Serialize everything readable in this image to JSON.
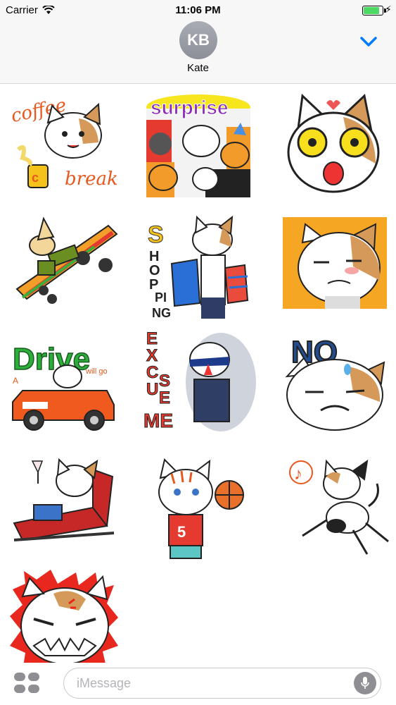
{
  "status_bar": {
    "carrier": "Carrier",
    "time": "11:06 PM",
    "icons": [
      "wifi-icon",
      "battery-icon",
      "charging-bolt-icon"
    ]
  },
  "header": {
    "avatar_initials": "KB",
    "contact_name": "Kate",
    "collapse_icon": "chevron-down-icon",
    "accent_color": "#007aff"
  },
  "stickers": [
    {
      "caption": "coffee break"
    },
    {
      "caption": "surprise"
    },
    {
      "caption": ""
    },
    {
      "caption": ""
    },
    {
      "caption": "SHOPPING"
    },
    {
      "caption": ""
    },
    {
      "caption": "Drive",
      "sub_a": "A",
      "sub_b": "will go"
    },
    {
      "caption": "EXCUSE ME"
    },
    {
      "caption": "NO"
    },
    {
      "caption": ""
    },
    {
      "caption": "5"
    },
    {
      "caption": "♪"
    },
    {
      "caption": ""
    }
  ],
  "input_bar": {
    "placeholder": "iMessage",
    "apps_icon": "app-drawer-icon",
    "mic_icon": "microphone-icon"
  }
}
